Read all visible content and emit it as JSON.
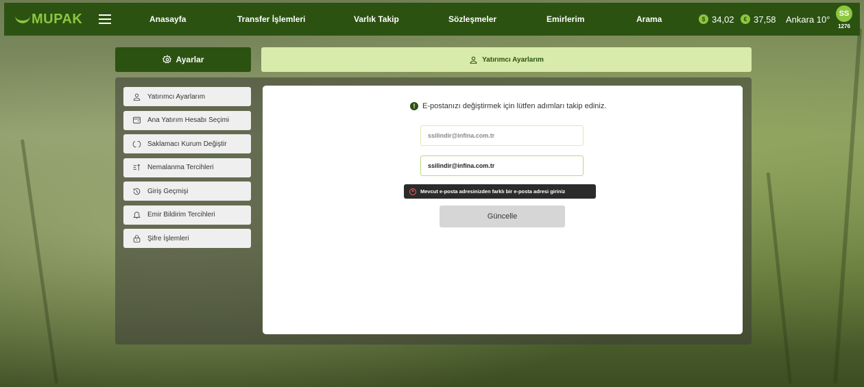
{
  "app": {
    "logo": "MUPAK"
  },
  "nav": {
    "items": [
      "Anasayfa",
      "Transfer İşlemleri",
      "Varlık Takip",
      "Sözleşmeler",
      "Emirlerim",
      "Arama"
    ],
    "usd": "34,02",
    "eur": "37,58",
    "weather": "Ankara 10°",
    "usd_symbol": "$",
    "eur_symbol": "€",
    "avatar_initials": "SS",
    "avatar_number": "1276"
  },
  "header": {
    "settings_label": "Ayarlar",
    "section_title": "Yatırımcı Ayarlarım"
  },
  "sidebar": {
    "items": [
      {
        "label": "Yatırımcı Ayarlarım",
        "icon": "user-icon"
      },
      {
        "label": "Ana Yatırım Hesabı Seçimi",
        "icon": "wallet-icon"
      },
      {
        "label": "Saklamacı Kurum Değiştir",
        "icon": "refresh-icon"
      },
      {
        "label": "Nemalanma Tercihleri",
        "icon": "sort-icon"
      },
      {
        "label": "Giriş Geçmişi",
        "icon": "history-icon"
      },
      {
        "label": "Emir Bildirim Tercihleri",
        "icon": "bell-icon"
      },
      {
        "label": "Şifre İşlemleri",
        "icon": "lock-icon"
      }
    ]
  },
  "form": {
    "info_text": "E-postanızı değiştirmek için lütfen adımları takip ediniz.",
    "current_email": "ssilindir@infina.com.tr",
    "new_email": "ssilindir@infina.com.tr",
    "error_text": "Mevcut e-posta adresinizden farklı bir e-posta adresi giriniz",
    "update_button": "Güncelle"
  },
  "colors": {
    "primary": "#2c5212",
    "accent": "#8dc63f",
    "highlight": "#d8ebab"
  }
}
